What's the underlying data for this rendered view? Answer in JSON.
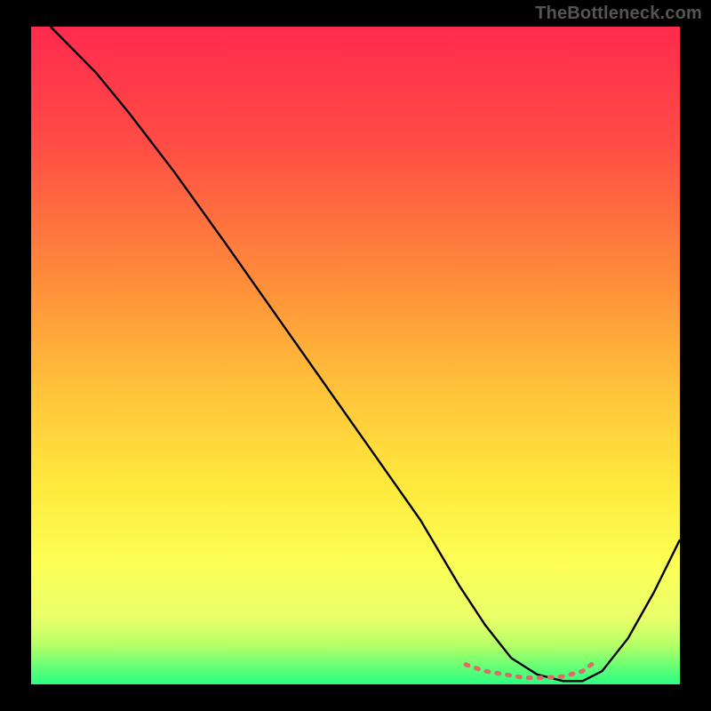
{
  "watermark": "TheBottleneck.com",
  "chart_data": {
    "type": "line",
    "title": "",
    "xlabel": "",
    "ylabel": "",
    "xlim": [
      0,
      100
    ],
    "ylim": [
      0,
      100
    ],
    "grid": false,
    "legend": false,
    "background_gradient_stops": [
      {
        "offset": 0.0,
        "color": "#ff2a4d"
      },
      {
        "offset": 0.18,
        "color": "#ff4d45"
      },
      {
        "offset": 0.38,
        "color": "#ff8b3a"
      },
      {
        "offset": 0.55,
        "color": "#ffc23a"
      },
      {
        "offset": 0.7,
        "color": "#ffea3d"
      },
      {
        "offset": 0.82,
        "color": "#fcff56"
      },
      {
        "offset": 0.9,
        "color": "#e8ff6a"
      },
      {
        "offset": 0.94,
        "color": "#b6ff66"
      },
      {
        "offset": 0.97,
        "color": "#6dff74"
      },
      {
        "offset": 1.0,
        "color": "#2bff82"
      }
    ],
    "series": [
      {
        "name": "bottleneck-curve",
        "stroke": "#000000",
        "stroke_width": 2.4,
        "x": [
          3,
          6,
          10,
          15,
          22,
          30,
          40,
          50,
          60,
          66,
          70,
          74,
          78,
          82,
          85,
          88,
          92,
          96,
          100
        ],
        "y": [
          100,
          97,
          93,
          87,
          78,
          67,
          53,
          39,
          25,
          15,
          9,
          4,
          1.5,
          0.5,
          0.5,
          2,
          7,
          14,
          22
        ]
      }
    ],
    "highlight_band": {
      "name": "optimal-range",
      "stroke": "#e06a6a",
      "stroke_width": 5,
      "dash": "3 9",
      "x": [
        67,
        70,
        73,
        76,
        79,
        82,
        85,
        87
      ],
      "y": [
        3,
        2,
        1.5,
        1,
        1,
        1.2,
        2,
        3.5
      ]
    }
  }
}
